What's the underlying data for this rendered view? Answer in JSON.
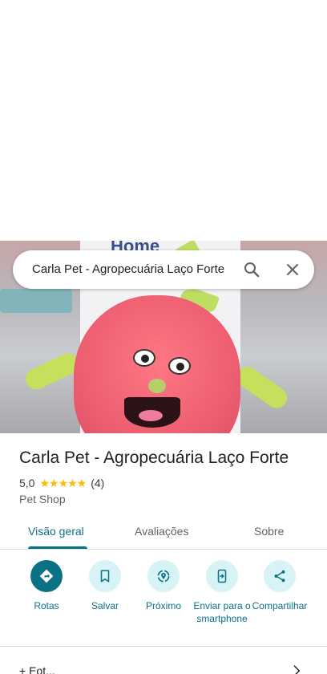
{
  "search": {
    "query": "Carla Pet - Agropecuária Laço Forte"
  },
  "photo": {
    "card_text": "Home"
  },
  "place": {
    "title": "Carla Pet - Agropecuária Laço Forte",
    "rating": "5,0",
    "stars": "★★★★★",
    "review_count": "(4)",
    "category": "Pet Shop"
  },
  "tabs": [
    {
      "label": "Visão geral",
      "active": true
    },
    {
      "label": "Avaliações",
      "active": false
    },
    {
      "label": "Sobre",
      "active": false
    }
  ],
  "actions": [
    {
      "label": "Rotas",
      "icon": "directions-icon"
    },
    {
      "label": "Salvar",
      "icon": "bookmark-icon"
    },
    {
      "label": "Próximo",
      "icon": "nearby-icon"
    },
    {
      "label": "Enviar para o smartphone",
      "icon": "send-to-phone-icon"
    },
    {
      "label": "Compartilhar",
      "icon": "share-icon"
    }
  ],
  "bottom": {
    "partial_text": "+ Eot..."
  },
  "colors": {
    "accent": "#0b7285",
    "accent_light": "#d7f3f6",
    "star": "#fbbc04"
  }
}
